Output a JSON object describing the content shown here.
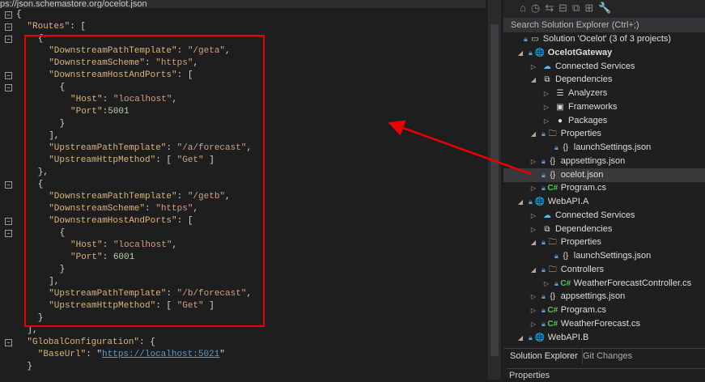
{
  "editor": {
    "schema_url": "ps://json.schemastore.org/ocelot.json",
    "lines": [
      {
        "indent": 0,
        "parts": [
          [
            "p",
            "{"
          ]
        ]
      },
      {
        "indent": 1,
        "parts": [
          [
            "k",
            "\"Routes\""
          ],
          [
            "p",
            ": ["
          ]
        ]
      },
      {
        "indent": 2,
        "parts": [
          [
            "p",
            "{"
          ]
        ]
      },
      {
        "indent": 3,
        "parts": [
          [
            "k",
            "\"DownstreamPathTemplate\""
          ],
          [
            "p",
            ": "
          ],
          [
            "s",
            "\"/geta\""
          ],
          [
            "p",
            ","
          ]
        ]
      },
      {
        "indent": 3,
        "parts": [
          [
            "k",
            "\"DownstreamScheme\""
          ],
          [
            "p",
            ": "
          ],
          [
            "s",
            "\"https\""
          ],
          [
            "p",
            ","
          ]
        ]
      },
      {
        "indent": 3,
        "parts": [
          [
            "k",
            "\"DownstreamHostAndPorts\""
          ],
          [
            "p",
            ": ["
          ]
        ]
      },
      {
        "indent": 4,
        "parts": [
          [
            "p",
            "{"
          ]
        ]
      },
      {
        "indent": 5,
        "parts": [
          [
            "k",
            "\"Host\""
          ],
          [
            "p",
            ": "
          ],
          [
            "s",
            "\"localhost\""
          ],
          [
            "p",
            ","
          ]
        ]
      },
      {
        "indent": 5,
        "parts": [
          [
            "k",
            "\"Port\""
          ],
          [
            "p",
            ":"
          ],
          [
            "n",
            "5001"
          ]
        ]
      },
      {
        "indent": 4,
        "parts": [
          [
            "p",
            "}"
          ]
        ]
      },
      {
        "indent": 3,
        "parts": [
          [
            "p",
            "],"
          ]
        ]
      },
      {
        "indent": 3,
        "parts": [
          [
            "k",
            "\"UpstreamPathTemplate\""
          ],
          [
            "p",
            ": "
          ],
          [
            "s",
            "\"/a/forecast\""
          ],
          [
            "p",
            ","
          ]
        ]
      },
      {
        "indent": 3,
        "parts": [
          [
            "k",
            "\"UpstreamHttpMethod\""
          ],
          [
            "p",
            ": [ "
          ],
          [
            "s",
            "\"Get\""
          ],
          [
            "p",
            " ]"
          ]
        ]
      },
      {
        "indent": 2,
        "parts": [
          [
            "p",
            "},"
          ]
        ]
      },
      {
        "indent": 2,
        "parts": [
          [
            "p",
            "{"
          ]
        ]
      },
      {
        "indent": 3,
        "parts": [
          [
            "k",
            "\"DownstreamPathTemplate\""
          ],
          [
            "p",
            ": "
          ],
          [
            "s",
            "\"/getb\""
          ],
          [
            "p",
            ","
          ]
        ]
      },
      {
        "indent": 3,
        "parts": [
          [
            "k",
            "\"DownstreamScheme\""
          ],
          [
            "p",
            ": "
          ],
          [
            "s",
            "\"https\""
          ],
          [
            "p",
            ","
          ]
        ]
      },
      {
        "indent": 3,
        "parts": [
          [
            "k",
            "\"DownstreamHostAndPorts\""
          ],
          [
            "p",
            ": ["
          ]
        ]
      },
      {
        "indent": 4,
        "parts": [
          [
            "p",
            "{"
          ]
        ]
      },
      {
        "indent": 5,
        "parts": [
          [
            "k",
            "\"Host\""
          ],
          [
            "p",
            ": "
          ],
          [
            "s",
            "\"localhost\""
          ],
          [
            "p",
            ","
          ]
        ]
      },
      {
        "indent": 5,
        "parts": [
          [
            "k",
            "\"Port\""
          ],
          [
            "p",
            ": "
          ],
          [
            "n",
            "6001"
          ]
        ]
      },
      {
        "indent": 4,
        "parts": [
          [
            "p",
            "}"
          ]
        ]
      },
      {
        "indent": 3,
        "parts": [
          [
            "p",
            "],"
          ]
        ]
      },
      {
        "indent": 3,
        "parts": [
          [
            "k",
            "\"UpstreamPathTemplate\""
          ],
          [
            "p",
            ": "
          ],
          [
            "s",
            "\"/b/forecast\""
          ],
          [
            "p",
            ","
          ]
        ]
      },
      {
        "indent": 3,
        "parts": [
          [
            "k",
            "\"UpstreamHttpMethod\""
          ],
          [
            "p",
            ": [ "
          ],
          [
            "s",
            "\"Get\""
          ],
          [
            "p",
            " ]"
          ]
        ]
      },
      {
        "indent": 2,
        "parts": [
          [
            "p",
            "}"
          ]
        ]
      },
      {
        "indent": 1,
        "parts": [
          [
            "p",
            "],"
          ]
        ]
      },
      {
        "indent": 1,
        "parts": [
          [
            "k",
            "\"GlobalConfiguration\""
          ],
          [
            "p",
            ": {"
          ]
        ]
      },
      {
        "indent": 2,
        "parts": [
          [
            "k",
            "\"BaseUrl\""
          ],
          [
            "p",
            ": \""
          ],
          [
            "u",
            "https://localhost:5021"
          ],
          [
            "p",
            "\""
          ]
        ]
      },
      {
        "indent": 1,
        "parts": [
          [
            "p",
            "}"
          ]
        ]
      }
    ],
    "fold_lines": [
      0,
      1,
      2,
      5,
      6,
      14,
      17,
      18,
      27
    ]
  },
  "solution_explorer": {
    "search_placeholder": "Search Solution Explorer (Ctrl+;)",
    "items": [
      {
        "label": "Solution 'Ocelot' (3 of 3 projects)",
        "level": 0,
        "exp": "",
        "lock": true,
        "icon": "▭"
      },
      {
        "label": "OcelotGateway",
        "level": 1,
        "exp": "◢",
        "lock": true,
        "icon": "🌐",
        "bold": true
      },
      {
        "label": "Connected Services",
        "level": 2,
        "exp": "▷",
        "lock": false,
        "icon": "☁"
      },
      {
        "label": "Dependencies",
        "level": 2,
        "exp": "◢",
        "lock": false,
        "icon": "⧉"
      },
      {
        "label": "Analyzers",
        "level": 3,
        "exp": "▷",
        "lock": false,
        "icon": "☰"
      },
      {
        "label": "Frameworks",
        "level": 3,
        "exp": "▷",
        "lock": false,
        "icon": "▣"
      },
      {
        "label": "Packages",
        "level": 3,
        "exp": "▷",
        "lock": false,
        "icon": "●"
      },
      {
        "label": "Properties",
        "level": 2,
        "exp": "◢",
        "lock": true,
        "icon": "🗀"
      },
      {
        "label": "launchSettings.json",
        "level": 3,
        "exp": "",
        "lock": true,
        "icon": "{}"
      },
      {
        "label": "appsettings.json",
        "level": 2,
        "exp": "▷",
        "lock": true,
        "icon": "{}"
      },
      {
        "label": "ocelot.json",
        "level": 2,
        "exp": "",
        "lock": true,
        "icon": "{}",
        "selected": true
      },
      {
        "label": "Program.cs",
        "level": 2,
        "exp": "▷",
        "lock": true,
        "icon": "C#"
      },
      {
        "label": "WebAPI.A",
        "level": 1,
        "exp": "◢",
        "lock": true,
        "icon": "🌐"
      },
      {
        "label": "Connected Services",
        "level": 2,
        "exp": "▷",
        "lock": false,
        "icon": "☁"
      },
      {
        "label": "Dependencies",
        "level": 2,
        "exp": "▷",
        "lock": false,
        "icon": "⧉"
      },
      {
        "label": "Properties",
        "level": 2,
        "exp": "◢",
        "lock": true,
        "icon": "🗀"
      },
      {
        "label": "launchSettings.json",
        "level": 3,
        "exp": "",
        "lock": true,
        "icon": "{}"
      },
      {
        "label": "Controllers",
        "level": 2,
        "exp": "◢",
        "lock": true,
        "icon": "🗀"
      },
      {
        "label": "WeatherForecastController.cs",
        "level": 3,
        "exp": "▷",
        "lock": true,
        "icon": "C#"
      },
      {
        "label": "appsettings.json",
        "level": 2,
        "exp": "▷",
        "lock": true,
        "icon": "{}"
      },
      {
        "label": "Program.cs",
        "level": 2,
        "exp": "▷",
        "lock": true,
        "icon": "C#"
      },
      {
        "label": "WeatherForecast.cs",
        "level": 2,
        "exp": "▷",
        "lock": true,
        "icon": "C#"
      },
      {
        "label": "WebAPI.B",
        "level": 1,
        "exp": "◢",
        "lock": true,
        "icon": "🌐"
      }
    ],
    "tabs": [
      "Solution Explorer",
      "Git Changes"
    ],
    "properties_label": "Properties"
  },
  "colors": {
    "annotation": "#e00000",
    "selected_row": "#3a3a3d"
  }
}
